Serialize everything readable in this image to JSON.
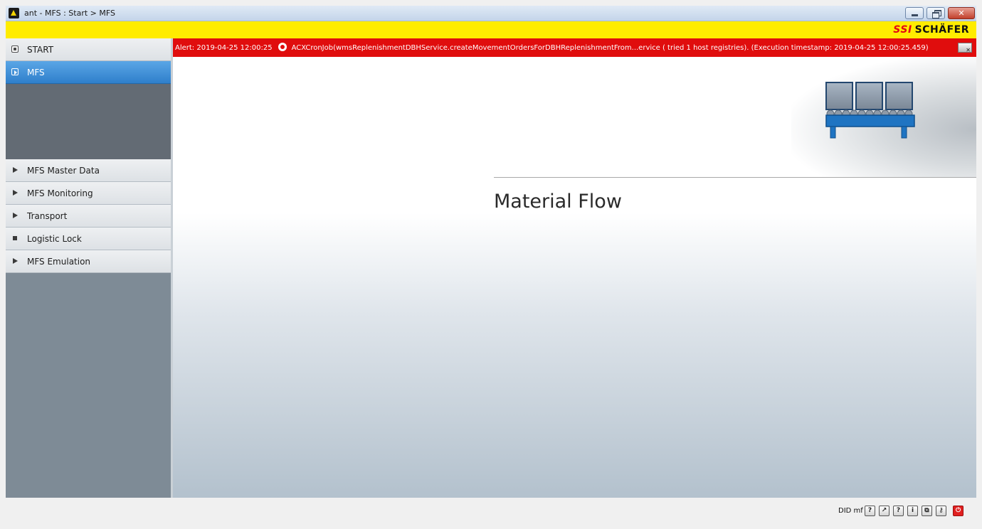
{
  "window": {
    "title": "ant - MFS : Start > MFS",
    "brand_prefix": "SSI",
    "brand_name": "SCHÄFER"
  },
  "sidebar": {
    "items": [
      {
        "label": "START",
        "icon": "square-dot-icon",
        "selected": false
      },
      {
        "label": "MFS",
        "icon": "play-box-icon",
        "selected": true
      },
      {
        "label": "MFS Master Data",
        "icon": "triangle-right-icon"
      },
      {
        "label": "MFS Monitoring",
        "icon": "triangle-right-icon"
      },
      {
        "label": "Transport",
        "icon": "triangle-right-icon"
      },
      {
        "label": "Logistic Lock",
        "icon": "small-square-icon"
      },
      {
        "label": "MFS Emulation",
        "icon": "triangle-right-icon"
      }
    ]
  },
  "alert": {
    "prefix": "Alert: 2019-04-25 12:00:25",
    "message": "ACXCronJob(wmsReplenishmentDBHService.createMovementOrdersForDBHReplenishmentFrom...ervice ( tried 1 host registries). (Execution timestamp: 2019-04-25 12:00:25.459)",
    "color": "#e00d0d"
  },
  "main": {
    "heading": "Material Flow",
    "illustration": "conveyor-icon"
  },
  "statusbar": {
    "user": "DID mf",
    "buttons": [
      {
        "name": "help-icon",
        "glyph": "?"
      },
      {
        "name": "external-window-icon",
        "glyph": "↗"
      },
      {
        "name": "context-help-icon",
        "glyph": "?"
      },
      {
        "name": "info-icon",
        "glyph": "i"
      },
      {
        "name": "windows-icon",
        "glyph": "⧉"
      },
      {
        "name": "key-icon",
        "glyph": "⚷"
      },
      {
        "name": "power-icon",
        "glyph": "⏻"
      }
    ]
  },
  "colors": {
    "brand_yellow": "#ffec00",
    "selected_blue": "#2f7fcb",
    "alert_red": "#e00d0d",
    "sidebar_gray": "#7e8b96"
  }
}
